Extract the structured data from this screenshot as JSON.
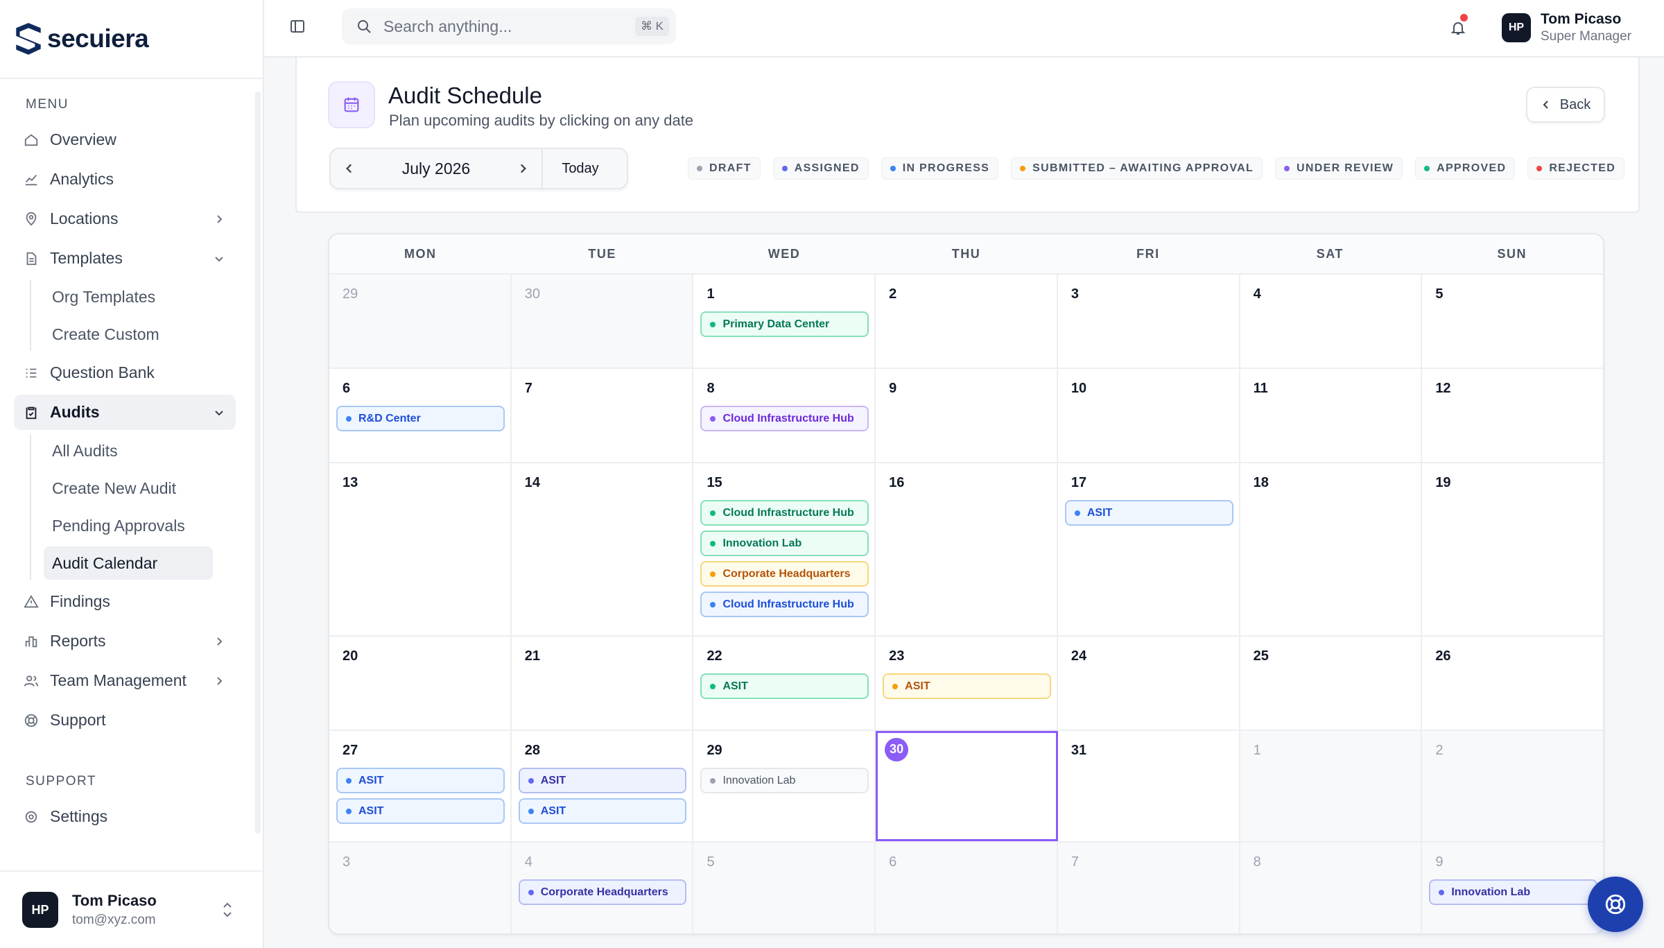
{
  "brand": {
    "name": "secuiera"
  },
  "sidebar": {
    "menu_title": "MENU",
    "items": [
      {
        "label": "Overview",
        "icon": "home-icon"
      },
      {
        "label": "Analytics",
        "icon": "chart-icon"
      },
      {
        "label": "Locations",
        "icon": "map-pin-icon",
        "chevron": "right"
      },
      {
        "label": "Templates",
        "icon": "document-icon",
        "chevron": "down"
      },
      {
        "label": "Question Bank",
        "icon": "list-icon"
      },
      {
        "label": "Audits",
        "icon": "clipboard-icon",
        "chevron": "down",
        "active": true
      },
      {
        "label": "Findings",
        "icon": "warning-icon"
      },
      {
        "label": "Reports",
        "icon": "bar-chart-icon",
        "chevron": "right"
      },
      {
        "label": "Team Management",
        "icon": "users-icon",
        "chevron": "right"
      },
      {
        "label": "Support",
        "icon": "lifebuoy-icon"
      }
    ],
    "templates_sub": [
      "Org Templates",
      "Create Custom"
    ],
    "audits_sub": [
      "All Audits",
      "Create New Audit",
      "Pending Approvals",
      "Audit Calendar"
    ],
    "audits_sub_active": "Audit Calendar",
    "support_title": "SUPPORT",
    "settings_label": "Settings"
  },
  "user": {
    "initials": "HP",
    "name": "Tom Picaso",
    "email": "tom@xyz.com",
    "role": "Super Manager"
  },
  "search": {
    "placeholder": "Search anything...",
    "shortcut": "⌘ K"
  },
  "notifications": {
    "has_unread": true
  },
  "page": {
    "title": "Audit Schedule",
    "subtitle": "Plan upcoming audits by clicking on any date",
    "back_label": "Back",
    "month_label": "July 2026",
    "today_label": "Today"
  },
  "legend": [
    {
      "label": "DRAFT",
      "color": "#9ca3af"
    },
    {
      "label": "ASSIGNED",
      "color": "#6366f1"
    },
    {
      "label": "IN PROGRESS",
      "color": "#3b82f6"
    },
    {
      "label": "SUBMITTED – AWAITING APPROVAL",
      "color": "#f59e0b"
    },
    {
      "label": "UNDER REVIEW",
      "color": "#8b5cf6"
    },
    {
      "label": "APPROVED",
      "color": "#10b981"
    },
    {
      "label": "REJECTED",
      "color": "#ef4444"
    }
  ],
  "calendar": {
    "weekdays": [
      "MON",
      "TUE",
      "WED",
      "THU",
      "FRI",
      "SAT",
      "SUN"
    ],
    "today": 30,
    "weeks": [
      [
        {
          "day": "29",
          "other": true,
          "events": []
        },
        {
          "day": "30",
          "other": true,
          "events": []
        },
        {
          "day": "1",
          "events": [
            {
              "name": "Primary Data Center",
              "status": "green"
            }
          ]
        },
        {
          "day": "2",
          "events": []
        },
        {
          "day": "3",
          "events": []
        },
        {
          "day": "4",
          "events": []
        },
        {
          "day": "5",
          "events": []
        }
      ],
      [
        {
          "day": "6",
          "events": [
            {
              "name": "R&D Center",
              "status": "blue"
            }
          ]
        },
        {
          "day": "7",
          "events": []
        },
        {
          "day": "8",
          "events": [
            {
              "name": "Cloud Infrastructure Hub",
              "status": "purple"
            }
          ]
        },
        {
          "day": "9",
          "events": []
        },
        {
          "day": "10",
          "events": []
        },
        {
          "day": "11",
          "events": []
        },
        {
          "day": "12",
          "events": []
        }
      ],
      [
        {
          "day": "13",
          "events": []
        },
        {
          "day": "14",
          "events": []
        },
        {
          "day": "15",
          "events": [
            {
              "name": "Cloud Infrastructure Hub",
              "status": "green"
            },
            {
              "name": "Innovation Lab",
              "status": "green"
            },
            {
              "name": "Corporate Headquarters",
              "status": "yellow"
            },
            {
              "name": "Cloud Infrastructure Hub",
              "status": "blue"
            }
          ]
        },
        {
          "day": "16",
          "events": []
        },
        {
          "day": "17",
          "events": [
            {
              "name": "ASIT",
              "status": "blue"
            }
          ]
        },
        {
          "day": "18",
          "events": []
        },
        {
          "day": "19",
          "events": []
        }
      ],
      [
        {
          "day": "20",
          "events": []
        },
        {
          "day": "21",
          "events": []
        },
        {
          "day": "22",
          "events": [
            {
              "name": "ASIT",
              "status": "green"
            }
          ]
        },
        {
          "day": "23",
          "events": [
            {
              "name": "ASIT",
              "status": "yellow"
            }
          ]
        },
        {
          "day": "24",
          "events": []
        },
        {
          "day": "25",
          "events": []
        },
        {
          "day": "26",
          "events": []
        }
      ],
      [
        {
          "day": "27",
          "events": [
            {
              "name": "ASIT",
              "status": "blue"
            },
            {
              "name": "ASIT",
              "status": "blue"
            }
          ]
        },
        {
          "day": "28",
          "events": [
            {
              "name": "ASIT",
              "status": "indigo"
            },
            {
              "name": "ASIT",
              "status": "blue"
            }
          ]
        },
        {
          "day": "29",
          "events": [
            {
              "name": "Innovation Lab",
              "status": "gray"
            }
          ]
        },
        {
          "day": "30",
          "today": true,
          "events": []
        },
        {
          "day": "31",
          "events": []
        },
        {
          "day": "1",
          "other": true,
          "events": []
        },
        {
          "day": "2",
          "other": true,
          "events": []
        }
      ],
      [
        {
          "day": "3",
          "other": true,
          "events": []
        },
        {
          "day": "4",
          "other": true,
          "events": [
            {
              "name": "Corporate Headquarters",
              "status": "indigo"
            }
          ]
        },
        {
          "day": "5",
          "other": true,
          "events": []
        },
        {
          "day": "6",
          "other": true,
          "events": []
        },
        {
          "day": "7",
          "other": true,
          "events": []
        },
        {
          "day": "8",
          "other": true,
          "events": []
        },
        {
          "day": "9",
          "other": true,
          "events": [
            {
              "name": "Innovation Lab",
              "status": "indigo"
            }
          ]
        }
      ]
    ]
  }
}
